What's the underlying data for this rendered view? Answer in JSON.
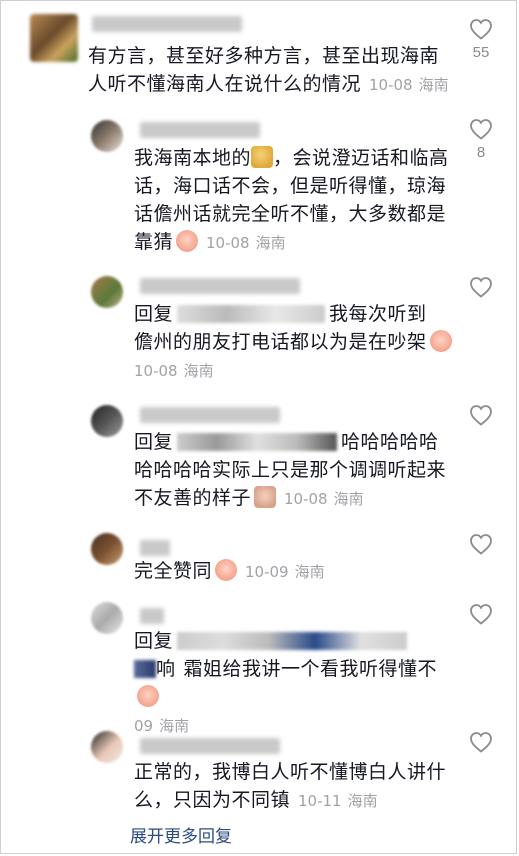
{
  "comments": [
    {
      "text": "有方言，甚至好多种方言，甚至出现海南人听不懂海南人在说什么的情况",
      "date": "10-08",
      "location": "海南",
      "likes": "55"
    },
    {
      "text_a": "我海南本地的",
      "text_b": "，会说澄迈话和临高话，海口话不会，但是听得懂，琼海话儋州话就完全听不懂，大多数都是靠猜",
      "date": "10-08",
      "location": "海南",
      "likes": "8"
    },
    {
      "reply_label": "回复",
      "text_a": "我每次听到",
      "text_b": "儋州的朋友打电话都以为是在吵架",
      "date": "10-08",
      "location": "海南"
    },
    {
      "reply_label": "回复",
      "text_a": "哈哈哈哈哈",
      "text_b": "哈哈哈哈实际上只是那个调调听起来",
      "text_c": "不友善的样子",
      "date": "10-08",
      "location": "海南"
    },
    {
      "text": "完全赞同",
      "date": "10-09",
      "location": "海南"
    },
    {
      "reply_label": "回复",
      "text_a": "响",
      "text_b": "霜姐给我讲一个看我听得懂不",
      "date": "09",
      "location": "海南"
    },
    {
      "text": "正常的，我博白人听不懂博白人讲什么，只因为不同镇",
      "date": "10-11",
      "location": "海南"
    }
  ],
  "expand_more": "展开更多回复",
  "colors": {
    "link": "#2d4a84",
    "meta": "#a1a2a7",
    "text": "#161823"
  },
  "icons": [
    "heart-outline-icon",
    "crying-emoji",
    "facepalm-emoji"
  ]
}
